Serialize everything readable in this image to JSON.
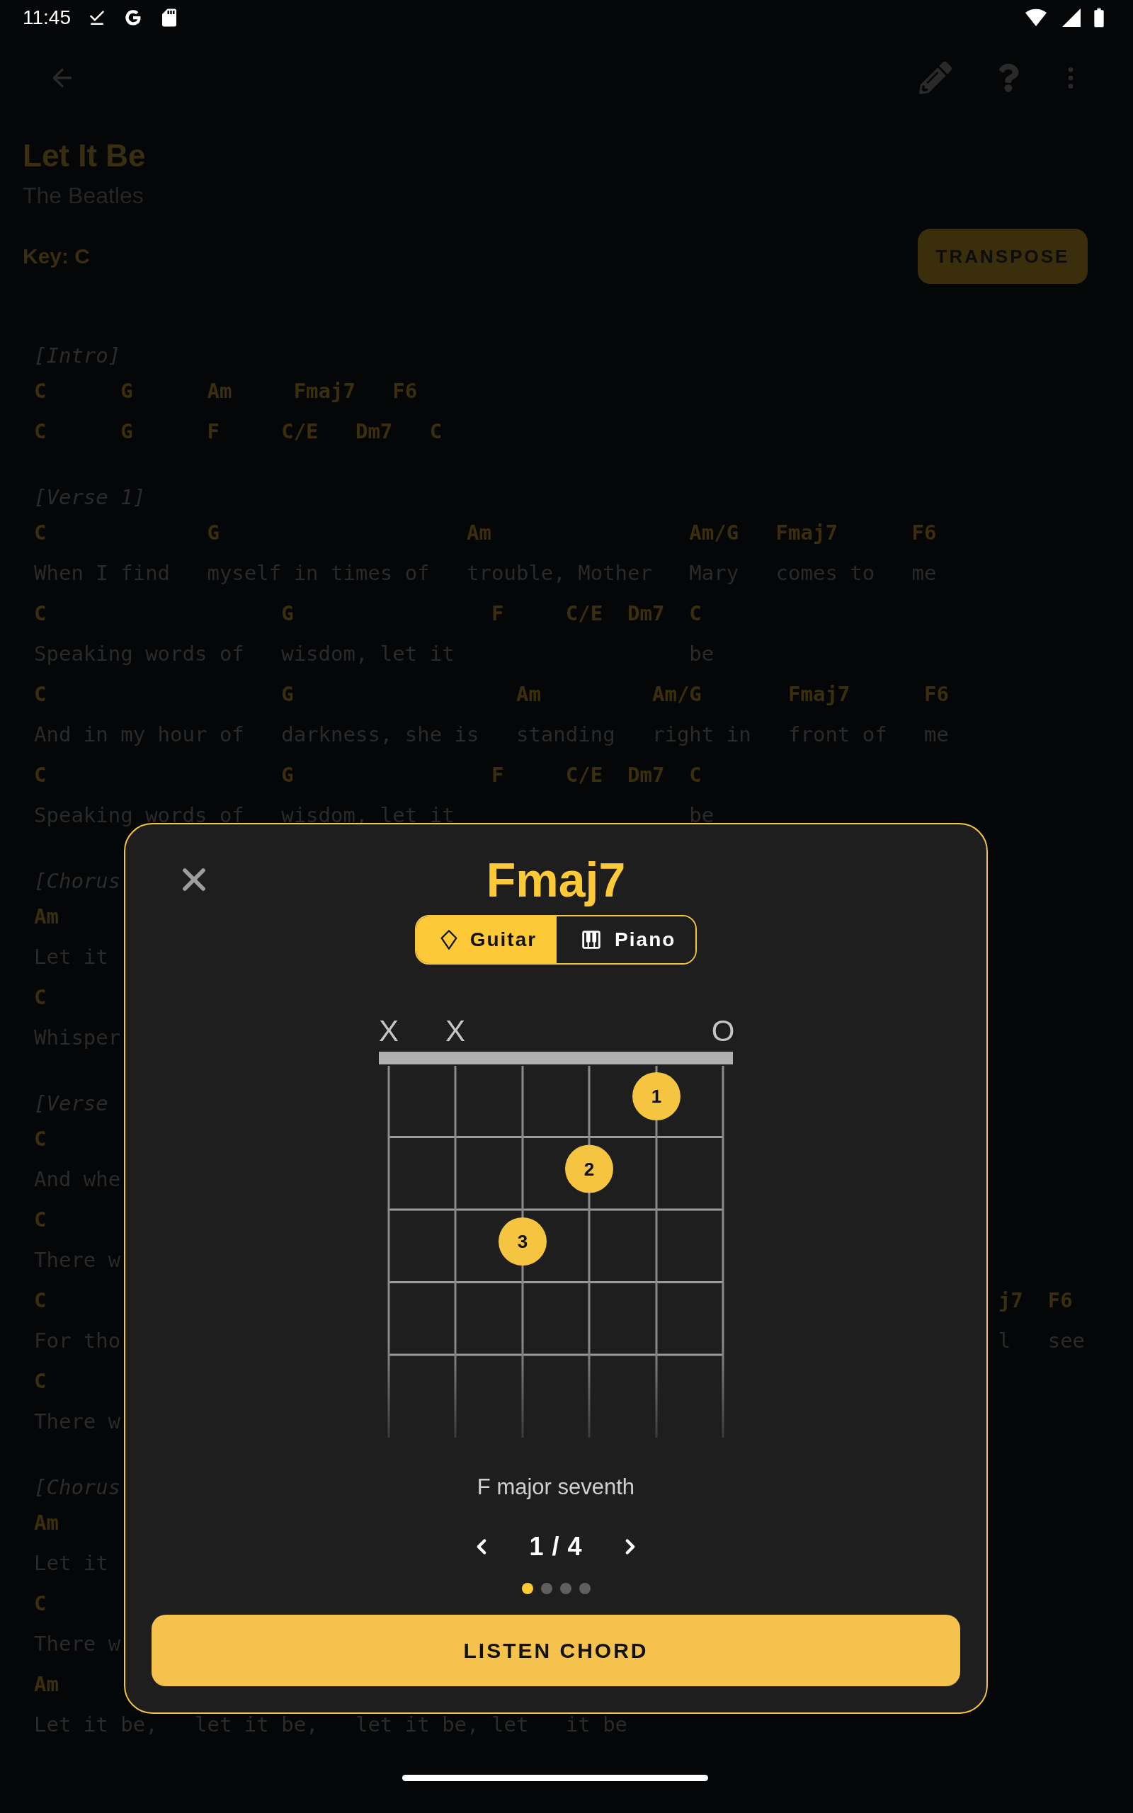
{
  "status_bar": {
    "time": "11:45"
  },
  "song": {
    "title": "Let It Be",
    "artist": "The Beatles",
    "key": "Key: C",
    "transpose_button": "TRANSPOSE"
  },
  "sheet": [
    {
      "kind": "label",
      "left": "[Intro]"
    },
    {
      "kind": "chords",
      "left": "C      G      Am     Fmaj7   F6"
    },
    {
      "kind": "chords",
      "left": "C      G      F     C/E   Dm7   C"
    },
    {
      "kind": "label",
      "left": "[Verse 1]"
    },
    {
      "kind": "chords",
      "left": "C             G                    Am                Am/G   Fmaj7      F6"
    },
    {
      "kind": "lyrics",
      "left": "When I find   myself in times of   trouble, Mother   Mary   comes to   me"
    },
    {
      "kind": "chords",
      "left": "C                   G                F     C/E  Dm7  C"
    },
    {
      "kind": "lyrics",
      "left": "Speaking words of   wisdom, let it                   be"
    },
    {
      "kind": "chords",
      "left": "C                   G                  Am         Am/G       Fmaj7      F6"
    },
    {
      "kind": "lyrics",
      "left": "And in my hour of   darkness, she is   standing   right in   front of   me"
    },
    {
      "kind": "chords",
      "left": "C                   G                F     C/E  Dm7  C"
    },
    {
      "kind": "lyrics",
      "left": "Speaking words of   wisdom, let it                   be"
    },
    {
      "kind": "label",
      "left": "[Chorus"
    },
    {
      "kind": "chords",
      "left": "Am"
    },
    {
      "kind": "lyrics",
      "left": "Let it"
    },
    {
      "kind": "chords",
      "left": "C"
    },
    {
      "kind": "lyrics",
      "left": "Whisper"
    },
    {
      "kind": "label",
      "left": "[Verse"
    },
    {
      "kind": "chords",
      "left": "C"
    },
    {
      "kind": "lyrics",
      "left": "And whe"
    },
    {
      "kind": "chords",
      "left": "C"
    },
    {
      "kind": "lyrics",
      "left": "There w"
    },
    {
      "kind": "chords",
      "left": "C",
      "right": "j7  F6"
    },
    {
      "kind": "lyrics",
      "left": "For tho",
      "right": "l   see"
    },
    {
      "kind": "chords",
      "left": "C"
    },
    {
      "kind": "lyrics",
      "left": "There w"
    },
    {
      "kind": "label",
      "left": "[Chorus"
    },
    {
      "kind": "chords",
      "left": "Am"
    },
    {
      "kind": "lyrics",
      "left": "Let it"
    },
    {
      "kind": "chords",
      "left": "C"
    },
    {
      "kind": "lyrics",
      "left": "There w"
    },
    {
      "kind": "chords",
      "left": "Am"
    },
    {
      "kind": "lyrics",
      "left": "Let it be,   let it be,   let it be, let   it be"
    }
  ],
  "dialog": {
    "chord": "Fmaj7",
    "tabs": [
      {
        "kind": "guitar",
        "label": "Guitar",
        "selected": true
      },
      {
        "kind": "piano",
        "label": "Piano",
        "selected": false
      }
    ],
    "diagram": {
      "strings": [
        {
          "mark": "X"
        },
        {
          "mark": "X"
        },
        {
          "finger": "3",
          "pressed": [
            false,
            false,
            true,
            false,
            false
          ]
        },
        {
          "finger": "2",
          "pressed": [
            false,
            true,
            false,
            false,
            false
          ]
        },
        {
          "finger": "1",
          "pressed": [
            true,
            false,
            false,
            false,
            false
          ]
        },
        {
          "mark": "O"
        }
      ]
    },
    "chord_name": "F major seventh",
    "pager": "1 / 4",
    "pages": [
      {
        "selected": true
      },
      {
        "selected": false
      },
      {
        "selected": false
      },
      {
        "selected": false
      }
    ],
    "listen_button": "LISTEN CHORD"
  }
}
